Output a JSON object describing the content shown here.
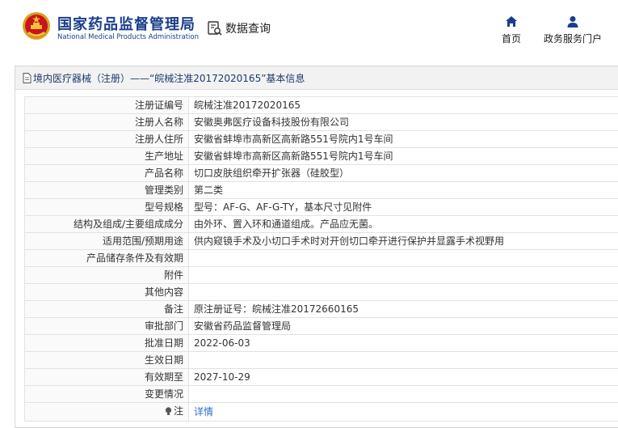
{
  "header": {
    "brand_cn": "国家药品监督管理局",
    "brand_en": "National Medical Products Administration",
    "query_label": "数据查询",
    "nav": {
      "home": "首页",
      "portal": "政务服务门户"
    }
  },
  "panel": {
    "title": "境内医疗器械（注册）——“皖械注准20172020165”基本信息"
  },
  "rows": [
    {
      "key": "注册证编号",
      "value": "皖械注准20172020165"
    },
    {
      "key": "注册人名称",
      "value": "安徽奥弗医疗设备科技股份有限公司"
    },
    {
      "key": "注册人住所",
      "value": "安徽省蚌埠市高新区高新路551号院内1号车间"
    },
    {
      "key": "生产地址",
      "value": "安徽省蚌埠市高新区高新路551号院内1号车间"
    },
    {
      "key": "产品名称",
      "value": "切口皮肤组织牵开扩张器（硅胶型）"
    },
    {
      "key": "管理类别",
      "value": "第二类"
    },
    {
      "key": "型号规格",
      "value": "型号：AF-G、AF-G-TY，基本尺寸见附件"
    },
    {
      "key": "结构及组成/主要组成成分",
      "value": "由外环、置入环和通道组成。产品应无菌。"
    },
    {
      "key": "适用范围/预期用途",
      "value": "供内窥镜手术及小切口手术时对开创切口牵开进行保护并显露手术视野用"
    },
    {
      "key": "产品储存条件及有效期",
      "value": ""
    },
    {
      "key": "附件",
      "value": ""
    },
    {
      "key": "其他内容",
      "value": ""
    },
    {
      "key": "备注",
      "value": "原注册证号：皖械注准20172660165"
    },
    {
      "key": "审批部门",
      "value": "安徽省药品监督管理局"
    },
    {
      "key": "批准日期",
      "value": "2022-06-03"
    },
    {
      "key": "生效日期",
      "value": ""
    },
    {
      "key": "有效期至",
      "value": "2027-10-29"
    },
    {
      "key": "变更情况",
      "value": ""
    }
  ],
  "note_row": {
    "key": "注",
    "link": "详情"
  },
  "colors": {
    "brand": "#1a3e8c",
    "link": "#2a6fc9",
    "title_text": "#1c3a6b"
  },
  "icons": {
    "emblem": "national-emblem-icon",
    "query": "data-search-icon",
    "home": "home-icon",
    "portal": "user-icon",
    "doc": "document-icon",
    "note": "lightbulb-icon"
  }
}
